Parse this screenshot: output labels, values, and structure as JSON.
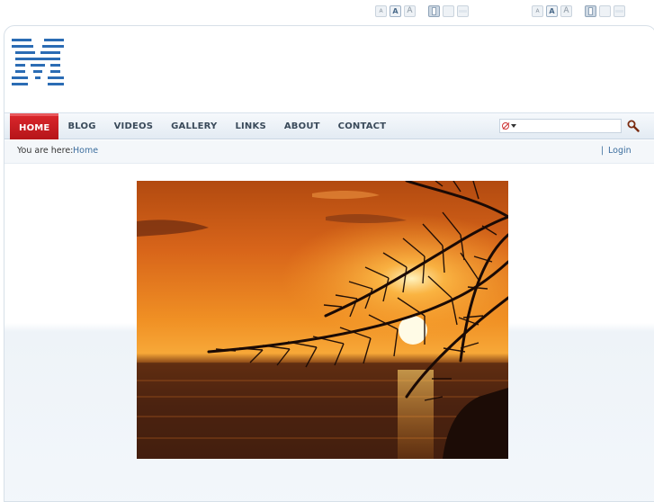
{
  "toolbar": {
    "font_small": "A",
    "font_default": "A",
    "font_large": "A"
  },
  "logo": {
    "icon": "m-logo-icon",
    "color": "#2b6cb4"
  },
  "nav": {
    "items": [
      {
        "label": "HOME",
        "active": true
      },
      {
        "label": "BLOG",
        "active": false
      },
      {
        "label": "VIDEOS",
        "active": false
      },
      {
        "label": "GALLERY",
        "active": false
      },
      {
        "label": "LINKS",
        "active": false
      },
      {
        "label": "ABOUT",
        "active": false
      },
      {
        "label": "CONTACT",
        "active": false
      }
    ],
    "active_color": "#c8191f",
    "search": {
      "value": "",
      "placeholder": ""
    }
  },
  "breadcrumb": {
    "label": "You are here:",
    "current": "Home"
  },
  "user": {
    "separator": "|",
    "login_label": "Login"
  },
  "main_image": {
    "subject": "sunset-over-sea-with-palm-fronds"
  }
}
